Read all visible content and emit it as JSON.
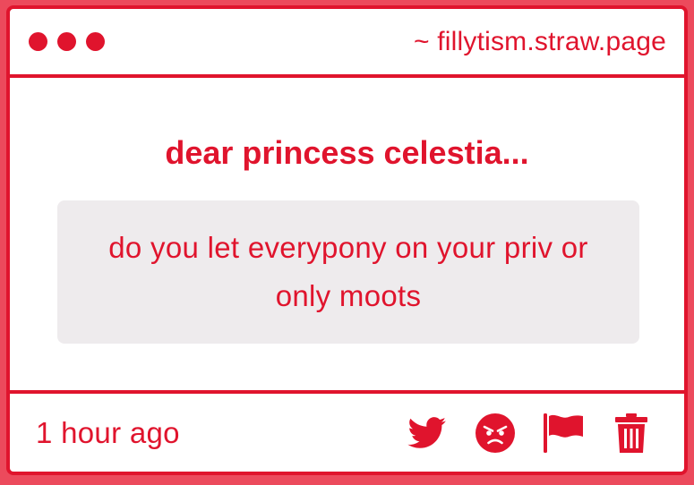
{
  "titlebar": {
    "url": "~ fillytism.straw.page"
  },
  "main": {
    "heading": "dear princess celestia...",
    "message": "do you let everypony on your priv or only moots"
  },
  "footer": {
    "timestamp": "1 hour ago",
    "actions": [
      {
        "icon": "twitter-icon"
      },
      {
        "icon": "angry-face-icon"
      },
      {
        "icon": "flag-icon"
      },
      {
        "icon": "trash-icon"
      }
    ]
  },
  "colors": {
    "accent": "#e0142d",
    "page_background": "#ec4a5c",
    "card_background": "#ffffff",
    "message_background": "#eeebed"
  }
}
